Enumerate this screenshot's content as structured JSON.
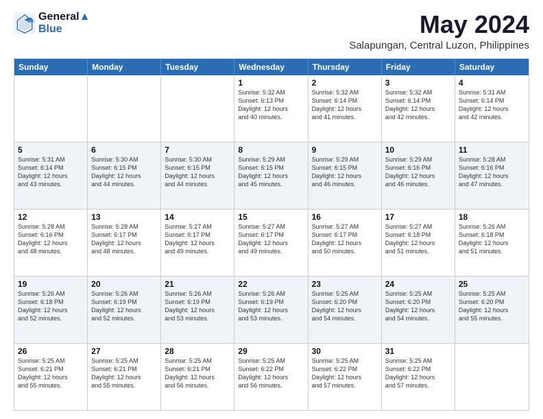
{
  "header": {
    "logo_line1": "General",
    "logo_line2": "Blue",
    "main_title": "May 2024",
    "subtitle": "Salapungan, Central Luzon, Philippines"
  },
  "calendar": {
    "days_of_week": [
      "Sunday",
      "Monday",
      "Tuesday",
      "Wednesday",
      "Thursday",
      "Friday",
      "Saturday"
    ],
    "rows": [
      {
        "alt": false,
        "cells": [
          {
            "day": "",
            "text": ""
          },
          {
            "day": "",
            "text": ""
          },
          {
            "day": "",
            "text": ""
          },
          {
            "day": "1",
            "text": "Sunrise: 5:32 AM\nSunset: 6:13 PM\nDaylight: 12 hours\nand 40 minutes."
          },
          {
            "day": "2",
            "text": "Sunrise: 5:32 AM\nSunset: 6:14 PM\nDaylight: 12 hours\nand 41 minutes."
          },
          {
            "day": "3",
            "text": "Sunrise: 5:32 AM\nSunset: 6:14 PM\nDaylight: 12 hours\nand 42 minutes."
          },
          {
            "day": "4",
            "text": "Sunrise: 5:31 AM\nSunset: 6:14 PM\nDaylight: 12 hours\nand 42 minutes."
          }
        ]
      },
      {
        "alt": true,
        "cells": [
          {
            "day": "5",
            "text": "Sunrise: 5:31 AM\nSunset: 6:14 PM\nDaylight: 12 hours\nand 43 minutes."
          },
          {
            "day": "6",
            "text": "Sunrise: 5:30 AM\nSunset: 6:15 PM\nDaylight: 12 hours\nand 44 minutes."
          },
          {
            "day": "7",
            "text": "Sunrise: 5:30 AM\nSunset: 6:15 PM\nDaylight: 12 hours\nand 44 minutes."
          },
          {
            "day": "8",
            "text": "Sunrise: 5:29 AM\nSunset: 6:15 PM\nDaylight: 12 hours\nand 45 minutes."
          },
          {
            "day": "9",
            "text": "Sunrise: 5:29 AM\nSunset: 6:15 PM\nDaylight: 12 hours\nand 46 minutes."
          },
          {
            "day": "10",
            "text": "Sunrise: 5:29 AM\nSunset: 6:16 PM\nDaylight: 12 hours\nand 46 minutes."
          },
          {
            "day": "11",
            "text": "Sunrise: 5:28 AM\nSunset: 6:16 PM\nDaylight: 12 hours\nand 47 minutes."
          }
        ]
      },
      {
        "alt": false,
        "cells": [
          {
            "day": "12",
            "text": "Sunrise: 5:28 AM\nSunset: 6:16 PM\nDaylight: 12 hours\nand 48 minutes."
          },
          {
            "day": "13",
            "text": "Sunrise: 5:28 AM\nSunset: 6:17 PM\nDaylight: 12 hours\nand 48 minutes."
          },
          {
            "day": "14",
            "text": "Sunrise: 5:27 AM\nSunset: 6:17 PM\nDaylight: 12 hours\nand 49 minutes."
          },
          {
            "day": "15",
            "text": "Sunrise: 5:27 AM\nSunset: 6:17 PM\nDaylight: 12 hours\nand 49 minutes."
          },
          {
            "day": "16",
            "text": "Sunrise: 5:27 AM\nSunset: 6:17 PM\nDaylight: 12 hours\nand 50 minutes."
          },
          {
            "day": "17",
            "text": "Sunrise: 5:27 AM\nSunset: 6:18 PM\nDaylight: 12 hours\nand 51 minutes."
          },
          {
            "day": "18",
            "text": "Sunrise: 5:26 AM\nSunset: 6:18 PM\nDaylight: 12 hours\nand 51 minutes."
          }
        ]
      },
      {
        "alt": true,
        "cells": [
          {
            "day": "19",
            "text": "Sunrise: 5:26 AM\nSunset: 6:18 PM\nDaylight: 12 hours\nand 52 minutes."
          },
          {
            "day": "20",
            "text": "Sunrise: 5:26 AM\nSunset: 6:19 PM\nDaylight: 12 hours\nand 52 minutes."
          },
          {
            "day": "21",
            "text": "Sunrise: 5:26 AM\nSunset: 6:19 PM\nDaylight: 12 hours\nand 53 minutes."
          },
          {
            "day": "22",
            "text": "Sunrise: 5:26 AM\nSunset: 6:19 PM\nDaylight: 12 hours\nand 53 minutes."
          },
          {
            "day": "23",
            "text": "Sunrise: 5:25 AM\nSunset: 6:20 PM\nDaylight: 12 hours\nand 54 minutes."
          },
          {
            "day": "24",
            "text": "Sunrise: 5:25 AM\nSunset: 6:20 PM\nDaylight: 12 hours\nand 54 minutes."
          },
          {
            "day": "25",
            "text": "Sunrise: 5:25 AM\nSunset: 6:20 PM\nDaylight: 12 hours\nand 55 minutes."
          }
        ]
      },
      {
        "alt": false,
        "cells": [
          {
            "day": "26",
            "text": "Sunrise: 5:25 AM\nSunset: 6:21 PM\nDaylight: 12 hours\nand 55 minutes."
          },
          {
            "day": "27",
            "text": "Sunrise: 5:25 AM\nSunset: 6:21 PM\nDaylight: 12 hours\nand 55 minutes."
          },
          {
            "day": "28",
            "text": "Sunrise: 5:25 AM\nSunset: 6:21 PM\nDaylight: 12 hours\nand 56 minutes."
          },
          {
            "day": "29",
            "text": "Sunrise: 5:25 AM\nSunset: 6:22 PM\nDaylight: 12 hours\nand 56 minutes."
          },
          {
            "day": "30",
            "text": "Sunrise: 5:25 AM\nSunset: 6:22 PM\nDaylight: 12 hours\nand 57 minutes."
          },
          {
            "day": "31",
            "text": "Sunrise: 5:25 AM\nSunset: 6:22 PM\nDaylight: 12 hours\nand 57 minutes."
          },
          {
            "day": "",
            "text": ""
          }
        ]
      }
    ]
  }
}
